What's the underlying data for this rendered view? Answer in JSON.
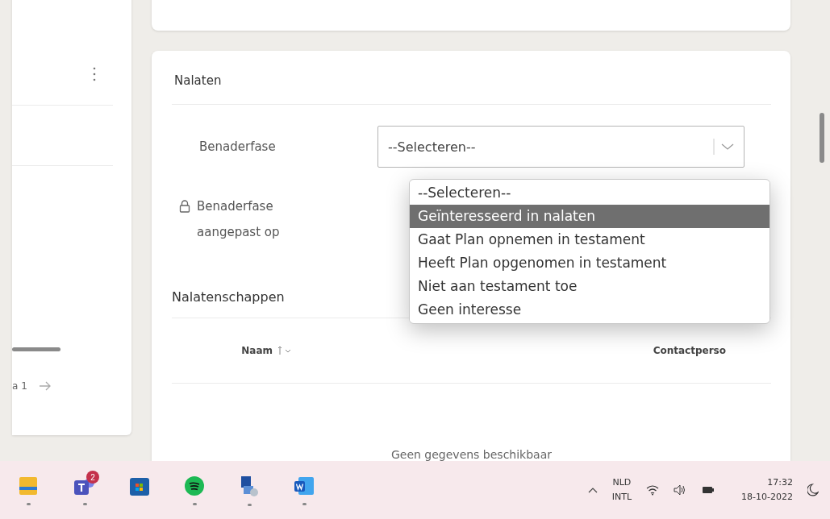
{
  "left_panel": {
    "footer_text": "a 1"
  },
  "section": {
    "title": "Nalaten",
    "fields": [
      {
        "kind": "select",
        "label": "Benaderfase",
        "value": "--Selecteren--"
      },
      {
        "kind": "locked",
        "label": "Benaderfase aangepast op"
      }
    ]
  },
  "dropdown": {
    "options": [
      {
        "label": "--Selecteren--",
        "selected": false
      },
      {
        "label": "Geïnteresseerd in nalaten",
        "selected": true
      },
      {
        "label": "Gaat Plan opnemen in testament",
        "selected": false
      },
      {
        "label": "Heeft Plan opgenomen in testament",
        "selected": false
      },
      {
        "label": "Niet aan testament toe",
        "selected": false
      },
      {
        "label": "Geen interesse",
        "selected": false
      }
    ]
  },
  "table": {
    "title": "Nalatenschappen",
    "columns": [
      {
        "label": "Naam",
        "sorted": true
      },
      {
        "label": "Contactperso",
        "sorted": false
      }
    ],
    "empty_text": "Geen gegevens beschikbaar"
  },
  "taskbar": {
    "apps": [
      {
        "kind": "folder",
        "running": true
      },
      {
        "kind": "chat",
        "running": true,
        "badge": "2"
      },
      {
        "kind": "store",
        "running": false
      },
      {
        "kind": "music",
        "running": true
      },
      {
        "kind": "network",
        "running": true
      },
      {
        "kind": "document",
        "running": true
      }
    ],
    "language": [
      "NLD",
      "INTL"
    ],
    "time": "17:32",
    "date": "18-10-2022"
  }
}
